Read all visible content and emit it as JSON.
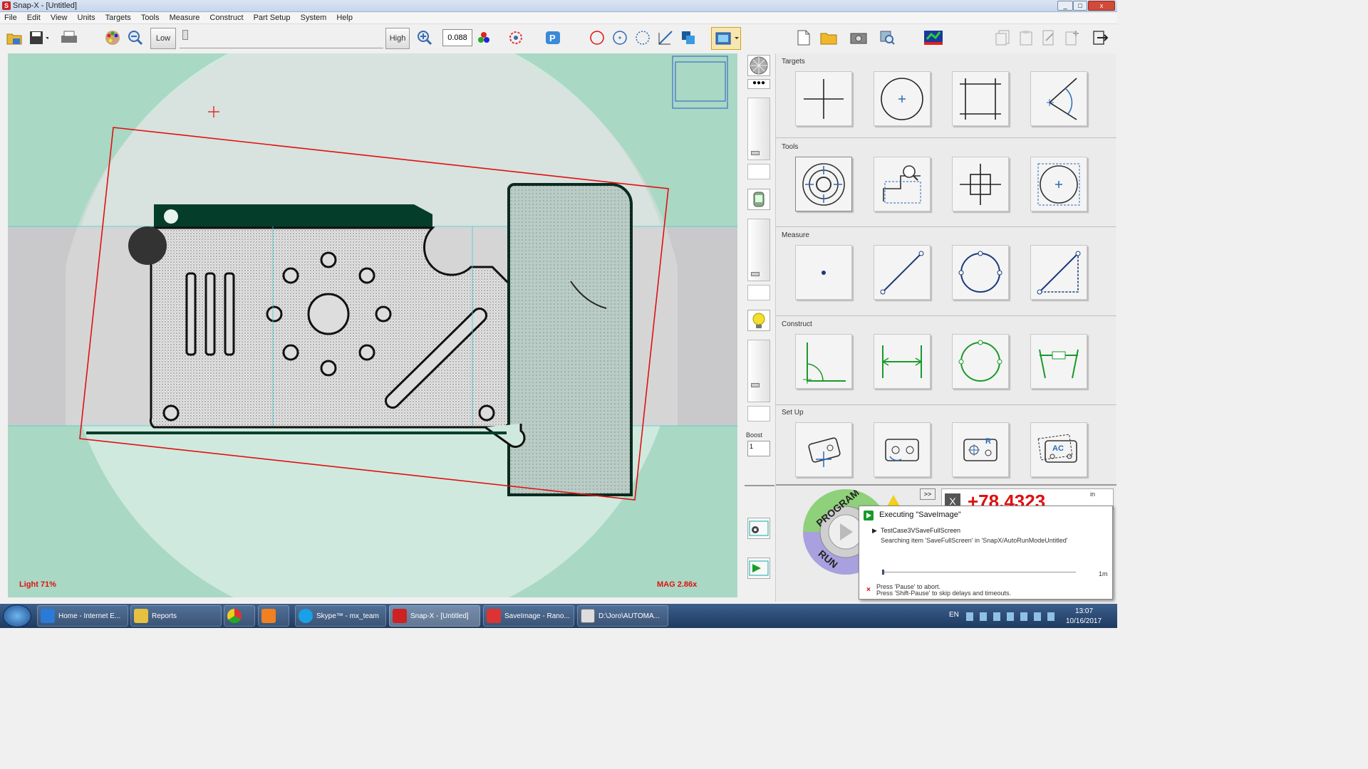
{
  "window": {
    "title": "Snap-X - [Untitled]",
    "minimize": "_",
    "maximize": "□",
    "close": "x"
  },
  "menu": [
    "File",
    "Edit",
    "View",
    "Units",
    "Targets",
    "Tools",
    "Measure",
    "Construct",
    "Part Setup",
    "System",
    "Help"
  ],
  "toolbar": {
    "low_label": "Low",
    "high_label": "High",
    "zoom_value": "0.088"
  },
  "viewport": {
    "light_label": "Light  71%",
    "mag_label": "MAG 2.86x"
  },
  "sidebar": {
    "boost_label": "Boost",
    "boost_value": "1"
  },
  "panel": {
    "targets_label": "Targets",
    "tools_label": "Tools",
    "measure_label": "Measure",
    "construct_label": "Construct",
    "setup_label": "Set Up",
    "expand": ">>",
    "dro_value": "+78.4323",
    "dro_unit": "in",
    "program_label": "PROGRAM",
    "run_label": "RUN"
  },
  "popup": {
    "title": "Executing \"SaveImage\"",
    "step": "TestCase3VSaveFullScreen",
    "searching": "Searching item 'SaveFullScreen' in 'SnapX/AutoRunModeUntitled'",
    "progress_end": "1m",
    "progress_fraction": 0.01,
    "hint1": "Press 'Pause' to abort.",
    "hint2": "Press 'Shift-Pause' to skip delays and timeouts."
  },
  "taskbar": {
    "items": [
      "Home - Internet E...",
      "Reports",
      "",
      "",
      "Skype™ - mx_team",
      "Snap-X - [Untitled]",
      "SaveImage - Rano...",
      "D:\\Joro\\AUTOMA..."
    ],
    "lang": "EN",
    "time": "13:07",
    "date": "10/16/2017"
  },
  "colors": {
    "accent_red": "#e01010",
    "roi_green": "#a9d8c4",
    "tool_blue": "#2a6ab8",
    "construct_green": "#1a9a2a"
  }
}
